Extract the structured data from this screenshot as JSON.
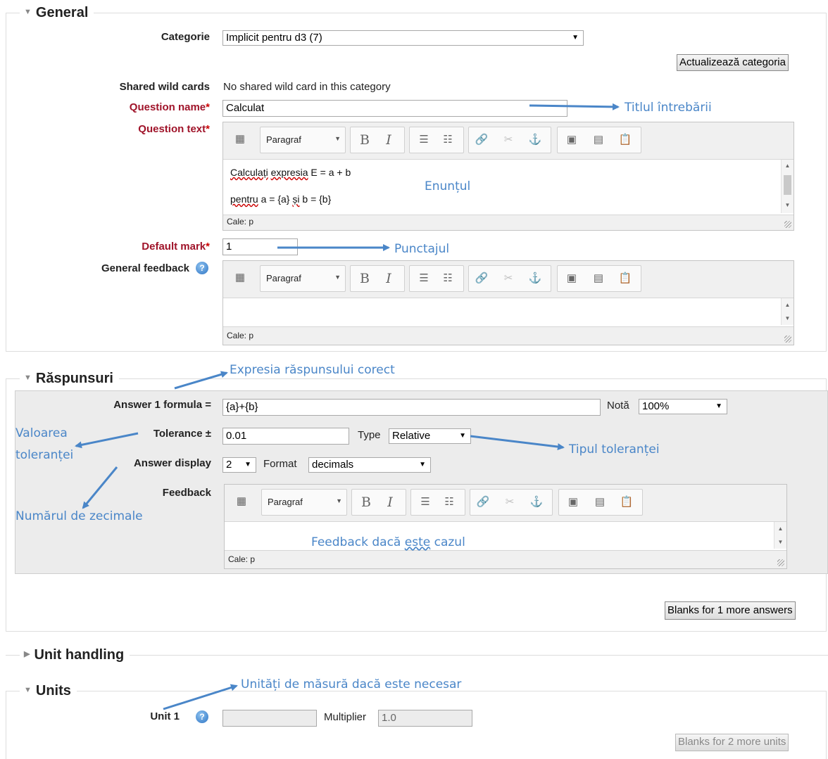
{
  "general": {
    "legend": "General",
    "categorie_label": "Categorie",
    "categorie_value": "Implicit pentru d3 (7)",
    "update_category_button": "Actualizează categoria",
    "shared_wild_cards_label": "Shared wild cards",
    "shared_wild_cards_value": "No shared wild card in this category",
    "question_name_label": "Question name",
    "question_name_value": "Calculat",
    "question_text_label": "Question text",
    "question_text_line1_word1": "Calculați",
    "question_text_line1_word2": "expresia",
    "question_text_line1_rest": "E = a + b",
    "question_text_line2_word1": "pentru",
    "question_text_line2_mid": "a = {a}",
    "question_text_line2_word2": "și",
    "question_text_line2_rest": "b = {b}",
    "default_mark_label": "Default mark",
    "default_mark_value": "1",
    "general_feedback_label": "General feedback",
    "required_mark": "*"
  },
  "editor": {
    "paragraph_label": "Paragraf",
    "path_label": "Cale: p"
  },
  "answers": {
    "legend": "Răspunsuri",
    "formula_label": "Answer 1 formula =",
    "formula_value": "{a}+{b}",
    "nota_label": "Notă",
    "nota_value": "100%",
    "tolerance_label": "Tolerance ±",
    "tolerance_value": "0.01",
    "type_label": "Type",
    "type_value": "Relative",
    "answer_display_label": "Answer display",
    "answer_display_value": "2",
    "format_label": "Format",
    "format_value": "decimals",
    "feedback_label": "Feedback",
    "more_answers_button": "Blanks for 1 more answers"
  },
  "unit_handling": {
    "legend": "Unit handling"
  },
  "units": {
    "legend": "Units",
    "unit1_label": "Unit 1",
    "unit1_value": "",
    "multiplier_label": "Multiplier",
    "multiplier_value": "1.0",
    "more_units_button": "Blanks for 2 more units"
  },
  "annotations": {
    "title": "Titlul întrebării",
    "statement": "Enunțul",
    "score": "Punctajul",
    "correct_expr": "Expresia răspunsului corect",
    "tolerance_value_1": "Valoarea",
    "tolerance_value_2": "toleranței",
    "tolerance_type": "Tipul toleranței",
    "decimals": "Numărul de zecimale",
    "feedback_prefix": "Feedback dacă",
    "feedback_word": "este",
    "feedback_suffix": "cazul",
    "units": "Unități de măsură dacă este necesar"
  },
  "colors": {
    "required_label": "#a0142a",
    "annotation": "#4a86c8"
  }
}
